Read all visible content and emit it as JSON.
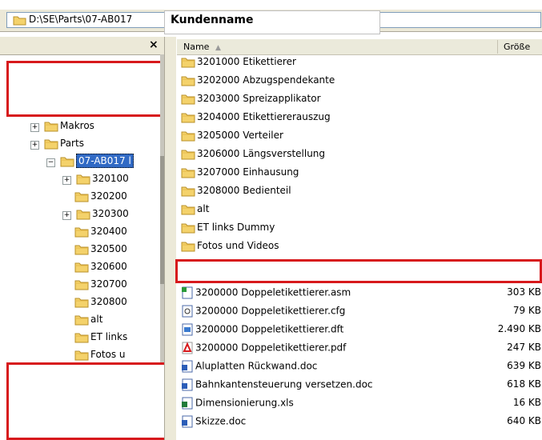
{
  "address_bar": {
    "path": "D:\\SE\\Parts\\07-AB017"
  },
  "kunden_label": "Kundenname",
  "left_panel": {
    "close_label": "×",
    "tree": [
      {
        "label": "Makros",
        "expander": "+",
        "indent": 0
      },
      {
        "label": "Parts",
        "expander": "+",
        "indent": 0
      },
      {
        "label": "07-AB017 l",
        "expander": "−",
        "indent": 1,
        "selected": true
      },
      {
        "label": "320100",
        "expander": "+",
        "indent": 2
      },
      {
        "label": "320200",
        "expander": "",
        "indent": 2
      },
      {
        "label": "320300",
        "expander": "+",
        "indent": 2
      },
      {
        "label": "320400",
        "expander": "",
        "indent": 2
      },
      {
        "label": "320500",
        "expander": "",
        "indent": 2
      },
      {
        "label": "320600",
        "expander": "",
        "indent": 2
      },
      {
        "label": "320700",
        "expander": "",
        "indent": 2
      },
      {
        "label": "320800",
        "expander": "",
        "indent": 2
      },
      {
        "label": "alt",
        "expander": "",
        "indent": 2
      },
      {
        "label": "ET links",
        "expander": "",
        "indent": 2
      },
      {
        "label": "Fotos u",
        "expander": "",
        "indent": 2
      }
    ]
  },
  "columns": {
    "name": "Name",
    "sort_indicator": "▲",
    "size": "Größe"
  },
  "folders": [
    "3201000 Etikettierer",
    "3202000 Abzugspendekante",
    "3203000 Spreizapplikator",
    "3204000 Etikettiererauszug",
    "3205000 Verteiler",
    "3206000 Längsverstellung",
    "3207000 Einhausung",
    "3208000 Bedienteil",
    "alt",
    "ET links Dummy",
    "Fotos und Videos"
  ],
  "files": [
    {
      "name": "3200000 Doppeletikettierer.asm",
      "size": "303 KB",
      "icon": "asm-icon"
    },
    {
      "name": "3200000 Doppeletikettierer.cfg",
      "size": "79 KB",
      "icon": "cfg-icon"
    },
    {
      "name": "3200000 Doppeletikettierer.dft",
      "size": "2.490 KB",
      "icon": "dft-icon"
    },
    {
      "name": "3200000 Doppeletikettierer.pdf",
      "size": "247 KB",
      "icon": "pdf-icon"
    },
    {
      "name": "Aluplatten Rückwand.doc",
      "size": "639 KB",
      "icon": "word-icon"
    },
    {
      "name": "Bahnkantensteuerung versetzen.doc",
      "size": "618 KB",
      "icon": "word-icon"
    },
    {
      "name": "Dimensionierung.xls",
      "size": "16 KB",
      "icon": "excel-icon"
    },
    {
      "name": "Skizze.doc",
      "size": "640 KB",
      "icon": "word-icon"
    }
  ],
  "colors": {
    "redaction_border": "#d7191c",
    "folder": "#f4d26b",
    "selection": "#316ac5"
  }
}
